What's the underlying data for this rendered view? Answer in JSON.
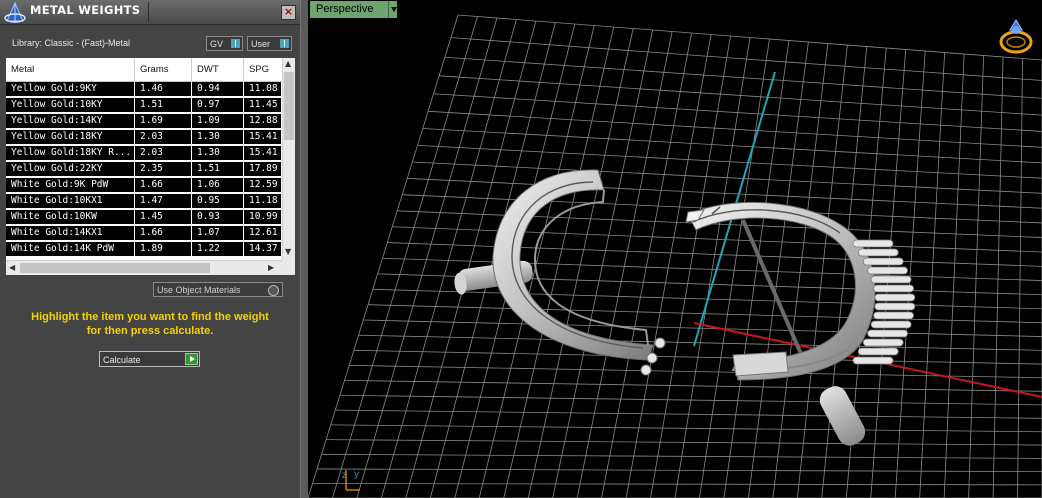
{
  "panel": {
    "title": "METAL WEIGHTS",
    "close_glyph": "×",
    "library_label": "Library: Classic - (Fast)-Metal",
    "toggle_gv": "GV",
    "toggle_user": "User",
    "columns": [
      "Metal",
      "Grams",
      "DWT",
      "SPG"
    ],
    "rows": [
      [
        "Yellow Gold:9KY",
        "1.46",
        "0.94",
        "11.08"
      ],
      [
        "Yellow Gold:10KY",
        "1.51",
        "0.97",
        "11.45"
      ],
      [
        "Yellow Gold:14KY",
        "1.69",
        "1.09",
        "12.88"
      ],
      [
        "Yellow Gold:18KY",
        "2.03",
        "1.30",
        "15.41"
      ],
      [
        "Yellow Gold:18KY R...",
        "2.03",
        "1.30",
        "15.41"
      ],
      [
        "Yellow Gold:22KY",
        "2.35",
        "1.51",
        "17.89"
      ],
      [
        "White Gold:9K PdW",
        "1.66",
        "1.06",
        "12.59"
      ],
      [
        "White Gold:10KX1",
        "1.47",
        "0.95",
        "11.18"
      ],
      [
        "White Gold:10KW",
        "1.45",
        "0.93",
        "10.99"
      ],
      [
        "White Gold:14KX1",
        "1.66",
        "1.07",
        "12.61"
      ],
      [
        "White Gold:14K PdW",
        "1.89",
        "1.22",
        "14.37"
      ]
    ],
    "use_object_materials": "Use Object Materials",
    "hint_line1": "Highlight the item you want to find the weight",
    "hint_line2": "for then press calculate.",
    "calculate_label": "Calculate"
  },
  "viewport": {
    "view_label": "Perspective",
    "axis_labels": {
      "y": "y",
      "z": "z"
    }
  },
  "colors": {
    "panel_bg": "#444444",
    "hint_yellow": "#f4d200",
    "view_label_bg": "#6fa46f",
    "grid": "#8a8a8a",
    "axis_x": "#c41818",
    "axis_y": "#1fa6b8"
  },
  "icons": {
    "logo": "gemvision-logo-icon",
    "close": "close-icon",
    "view_cube": "ring-orientation-icon",
    "calculate_go": "play-arrow-icon"
  }
}
